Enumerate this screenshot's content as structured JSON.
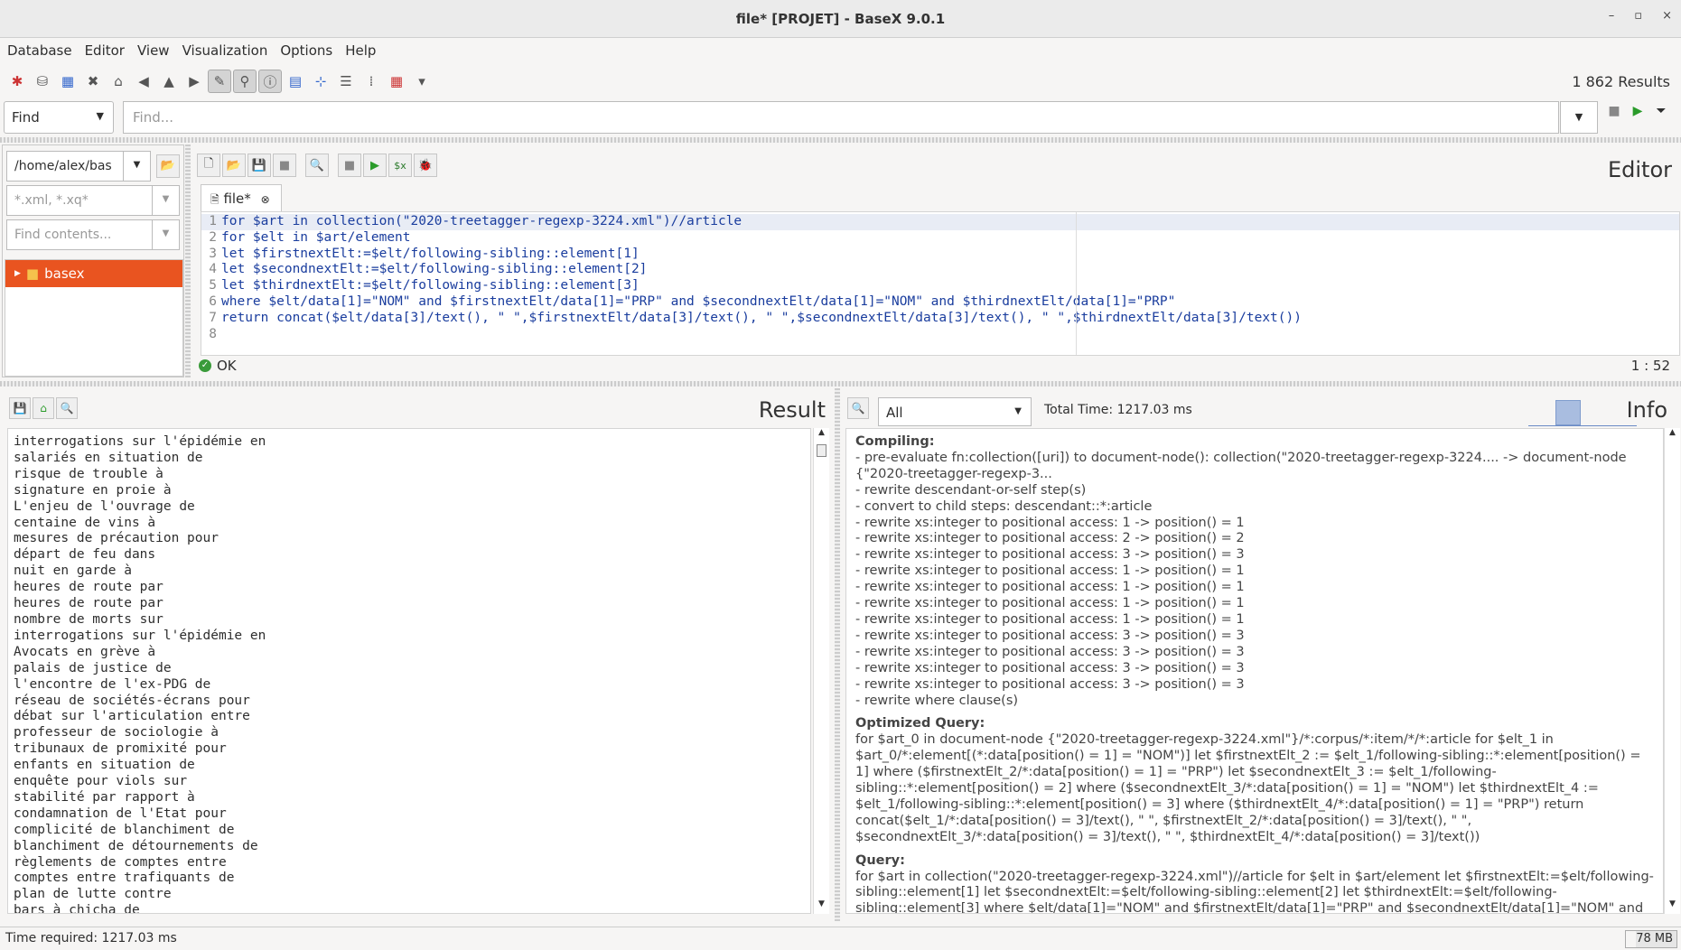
{
  "window": {
    "title": "file* [PROJET] - BaseX 9.0.1",
    "minimize": "–",
    "maximize": "▫",
    "close": "×"
  },
  "menu": [
    "Database",
    "Editor",
    "View",
    "Visualization",
    "Options",
    "Help"
  ],
  "toolbar": {
    "results": "1 862 Results"
  },
  "find": {
    "mode": "Find",
    "placeholder": "Find..."
  },
  "project": {
    "path": "/home/alex/bas",
    "filter_placeholder": "*.xml, *.xq*",
    "contents_placeholder": "Find contents...",
    "root": "basex"
  },
  "editor": {
    "title": "Editor",
    "tab": "file*",
    "lines": [
      "for $art in collection(\"2020-treetagger-regexp-3224.xml\")//article",
      "for $elt in $art/element",
      "let $firstnextElt:=$elt/following-sibling::element[1]",
      "let $secondnextElt:=$elt/following-sibling::element[2]",
      "let $thirdnextElt:=$elt/following-sibling::element[3]",
      "where $elt/data[1]=\"NOM\" and $firstnextElt/data[1]=\"PRP\" and $secondnextElt/data[1]=\"NOM\" and $thirdnextElt/data[1]=\"PRP\"",
      "return concat($elt/data[3]/text(), \" \",$firstnextElt/data[3]/text(), \" \",$secondnextElt/data[3]/text(), \" \",$thirdnextElt/data[3]/text())",
      ""
    ],
    "status": "OK",
    "cursor": "1 : 52"
  },
  "result": {
    "title": "Result",
    "lines": [
      "interrogations sur l'épidémie en",
      "salariés en situation de",
      "risque de trouble à",
      "signature en proie à",
      "L'enjeu de l'ouvrage de",
      "centaine de vins à",
      "mesures de précaution pour",
      "départ de feu dans",
      "nuit en garde à",
      "heures de route par",
      "heures de route par",
      "nombre de morts sur",
      "interrogations sur l'épidémie en",
      "Avocats en grève à",
      "palais de justice de",
      "l'encontre de l'ex-PDG de",
      "réseau de sociétés-écrans pour",
      "débat sur l'articulation entre",
      "professeur de sociologie à",
      "tribunaux de promixité pour",
      "enfants en situation de",
      "enquête pour viols sur",
      "stabilité par rapport à",
      "condamnation de l'Etat pour",
      "complicité de blanchiment de",
      "blanchiment de détournements de",
      "règlements de comptes entre",
      "comptes entre trafiquants de",
      "plan de lutte contre",
      "bars à chicha de"
    ]
  },
  "info": {
    "title": "Info",
    "filter": "All",
    "total_time": "Total Time: 1217.03 ms",
    "compiling_label": "Compiling:",
    "compiling": [
      "- pre-evaluate fn:collection([uri]) to document-node(): collection(\"2020-treetagger-regexp-3224.... -> document-node {\"2020-treetagger-regexp-3...",
      "- rewrite descendant-or-self step(s)",
      "- convert to child steps: descendant::*:article",
      "- rewrite xs:integer to positional access: 1 -> position() = 1",
      "- rewrite xs:integer to positional access: 2 -> position() = 2",
      "- rewrite xs:integer to positional access: 3 -> position() = 3",
      "- rewrite xs:integer to positional access: 1 -> position() = 1",
      "- rewrite xs:integer to positional access: 1 -> position() = 1",
      "- rewrite xs:integer to positional access: 1 -> position() = 1",
      "- rewrite xs:integer to positional access: 1 -> position() = 1",
      "- rewrite xs:integer to positional access: 3 -> position() = 3",
      "- rewrite xs:integer to positional access: 3 -> position() = 3",
      "- rewrite xs:integer to positional access: 3 -> position() = 3",
      "- rewrite xs:integer to positional access: 3 -> position() = 3",
      "- rewrite where clause(s)"
    ],
    "optimized_label": "Optimized Query:",
    "optimized": "for $art_0 in document-node {\"2020-treetagger-regexp-3224.xml\"}/*:corpus/*:item/*/*:article for $elt_1 in $art_0/*:element[(*:data[position() = 1] = \"NOM\")] let $firstnextElt_2 := $elt_1/following-sibling::*:element[position() = 1] where ($firstnextElt_2/*:data[position() = 1] = \"PRP\") let $secondnextElt_3 := $elt_1/following-sibling::*:element[position() = 2] where ($secondnextElt_3/*:data[position() = 1] = \"NOM\") let $thirdnextElt_4 := $elt_1/following-sibling::*:element[position() = 3] where ($thirdnextElt_4/*:data[position() = 1] = \"PRP\") return concat($elt_1/*:data[position() = 3]/text(), \" \", $firstnextElt_2/*:data[position() = 3]/text(), \" \", $secondnextElt_3/*:data[position() = 3]/text(), \" \", $thirdnextElt_4/*:data[position() = 3]/text())",
    "query_label": "Query:",
    "query": "for $art in collection(\"2020-treetagger-regexp-3224.xml\")//article for $elt in $art/element let $firstnextElt:=$elt/following-sibling::element[1] let $secondnextElt:=$elt/following-sibling::element[2] let $thirdnextElt:=$elt/following-sibling::element[3] where $elt/data[1]=\"NOM\" and $firstnextElt/data[1]=\"PRP\" and $secondnextElt/data[1]=\"NOM\" and $"
  },
  "statusbar": {
    "time": "Time required: 1217.03 ms",
    "memory": "78 MB"
  },
  "colors": {
    "accent": "#e95420",
    "ok": "#3a9b3a",
    "code": "#1a3d9e"
  }
}
